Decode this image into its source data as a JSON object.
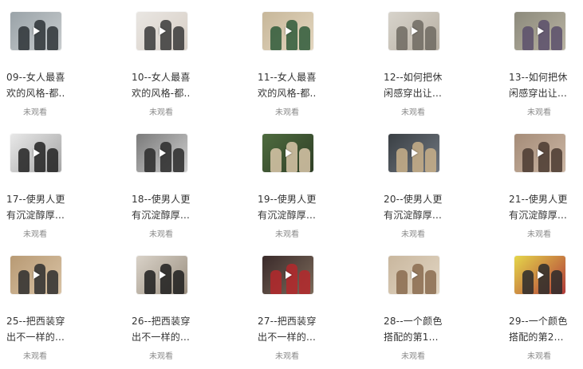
{
  "status_label": "未观看",
  "items": [
    {
      "line1": "09--女人最喜",
      "line2": " 欢的风格-都..",
      "colors": [
        "#9aa3a8",
        "#2d3236",
        "#c8ccce"
      ]
    },
    {
      "line1": "10--女人最喜",
      "line2": " 欢的风格-都..",
      "colors": [
        "#e9e6e2",
        "#3a3a3a",
        "#d8cfc6"
      ]
    },
    {
      "line1": "11--女人最喜",
      "line2": " 欢的风格-都..",
      "colors": [
        "#c7b79a",
        "#2f5a3a",
        "#e3d6bf"
      ]
    },
    {
      "line1": "12--如何把休",
      "line2": "闲感穿出让...",
      "colors": [
        "#d7d3cb",
        "#6f6a61",
        "#b8b0a3"
      ]
    },
    {
      "line1": "13--如何把休",
      "line2": "闲感穿出让...",
      "colors": [
        "#8c8a7c",
        "#5a4f6b",
        "#b9b3a2"
      ]
    },
    {
      "line1": "17--使男人更",
      "line2": "有沉淀醇厚...",
      "colors": [
        "#e8e8e8",
        "#222222",
        "#a5a5a5"
      ]
    },
    {
      "line1": "18--使男人更",
      "line2": "有沉淀醇厚...",
      "colors": [
        "#7a7a7a",
        "#2a2a2a",
        "#cfcfcf"
      ]
    },
    {
      "line1": "19--使男人更",
      "line2": "有沉淀醇厚...",
      "colors": [
        "#4e6b3f",
        "#d9c7a9",
        "#2f3f26"
      ]
    },
    {
      "line1": "20--使男人更",
      "line2": "有沉淀醇厚...",
      "colors": [
        "#3a3f44",
        "#c9b08a",
        "#707780"
      ]
    },
    {
      "line1": "21--使男人更",
      "line2": "有沉淀醇厚...",
      "colors": [
        "#a58c78",
        "#4a3a30",
        "#cbb6a4"
      ]
    },
    {
      "line1": "25--把西装穿",
      "line2": "出不一样的...",
      "colors": [
        "#b89a74",
        "#2e2e2e",
        "#d9c3a5"
      ]
    },
    {
      "line1": "26--把西装穿",
      "line2": "出不一样的...",
      "colors": [
        "#d9d2c8",
        "#1f1f1f",
        "#9a8f80"
      ]
    },
    {
      "line1": "27--把西装穿",
      "line2": "出不一样的...",
      "colors": [
        "#3a2a2a",
        "#b4282c",
        "#7c6b5b"
      ]
    },
    {
      "line1": "28--一个颜色",
      "line2": "搭配的第1...",
      "colors": [
        "#c9b79e",
        "#8a6b4f",
        "#e2d6c4"
      ]
    },
    {
      "line1": "29--一个颜色",
      "line2": "搭配的第2...",
      "colors": [
        "#e5d64a",
        "#2b2b2b",
        "#b23a3a"
      ]
    }
  ]
}
